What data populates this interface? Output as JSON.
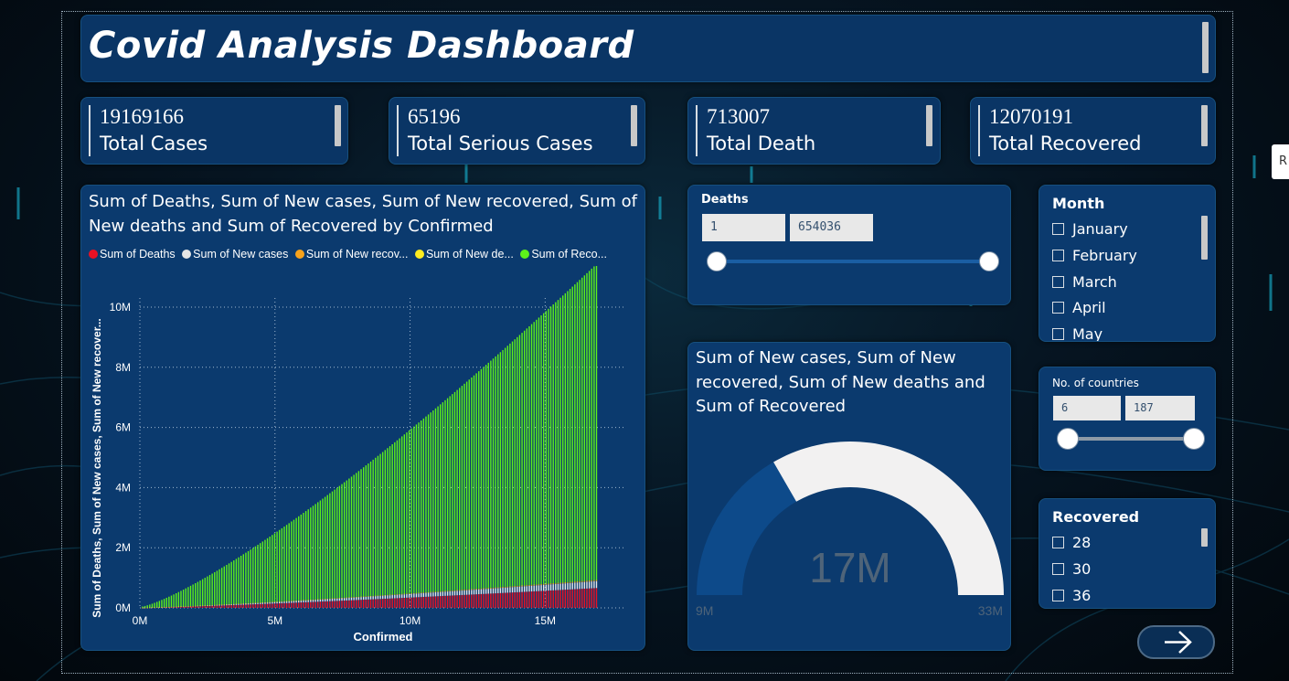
{
  "app": {
    "title": "Covid Analysis Dashboard",
    "side_tab_label": "R"
  },
  "kpis": [
    {
      "value": "19169166",
      "label": "Total Cases"
    },
    {
      "value": "65196",
      "label": "Total Serious Cases"
    },
    {
      "value": "713007",
      "label": "Total Death"
    },
    {
      "value": "12070191",
      "label": "Total Recovered"
    }
  ],
  "main_chart": {
    "title": "Sum of Deaths, Sum of New cases, Sum of New recovered, Sum of New deaths and Sum of Recovered by Confirmed",
    "legend": [
      {
        "label": "Sum of Deaths",
        "color": "#e81123"
      },
      {
        "label": "Sum of New cases",
        "color": "#e6e6e6"
      },
      {
        "label": "Sum of New recov...",
        "color": "#f7a21b"
      },
      {
        "label": "Sum of New de...",
        "color": "#ffec1f"
      },
      {
        "label": "Sum of Reco...",
        "color": "#5df21a"
      }
    ],
    "ylabel": "Sum of Deaths, Sum of New cases, Sum of New recover...",
    "xlabel": "Confirmed",
    "y_ticks": [
      "0M",
      "2M",
      "4M",
      "6M",
      "8M",
      "10M"
    ],
    "x_ticks": [
      "0M",
      "5M",
      "10M",
      "15M"
    ]
  },
  "chart_data": {
    "type": "bar",
    "title": "Sum of Deaths, Sum of New cases, Sum of New recovered, Sum of New deaths and Sum of Recovered by Confirmed",
    "xlabel": "Confirmed",
    "ylabel": "Sum of Deaths, Sum of New cases, Sum of New recover...",
    "xlim": [
      0,
      18000000
    ],
    "ylim": [
      0,
      10000000
    ],
    "x_range_data": [
      100000,
      16900000
    ],
    "bar_count": 190,
    "series": [
      {
        "name": "Sum of Deaths",
        "color": "#e81123",
        "start": 5000,
        "end": 660000
      },
      {
        "name": "Sum of New cases",
        "color": "#e6e6e6",
        "start": 1000,
        "end": 230000
      },
      {
        "name": "Sum of New recovered",
        "color": "#f7a21b",
        "start": 500,
        "end": 30000
      },
      {
        "name": "Sum of New deaths",
        "color": "#ffec1f",
        "start": 100,
        "end": 10000
      },
      {
        "name": "Sum of Recovered",
        "color": "#5df21a",
        "start": 40000,
        "end": 10500000
      }
    ],
    "grid": true,
    "legend_position": "top-left"
  },
  "deaths_slicer": {
    "label": "Deaths",
    "min_value": "1",
    "max_value": "654036"
  },
  "month_slicer": {
    "label": "Month",
    "items": [
      "January",
      "February",
      "March",
      "April",
      "May"
    ]
  },
  "countries_slicer": {
    "label": "No. of countries",
    "min_value": "6",
    "max_value": "187"
  },
  "recovered_slicer": {
    "label": "Recovered",
    "items": [
      "28",
      "30",
      "36"
    ]
  },
  "gauge": {
    "title": "Sum of New cases, Sum of New recovered, Sum of New deaths and Sum of Recovered",
    "value_label": "17M",
    "min_label": "9M",
    "max_label": "33M",
    "value": 17000000,
    "min": 9000000,
    "max": 33000000,
    "fill_color": "#0d4a8a",
    "track_color": "#f2f1f1"
  },
  "nav": {
    "next_icon": "arrow-right-icon"
  }
}
